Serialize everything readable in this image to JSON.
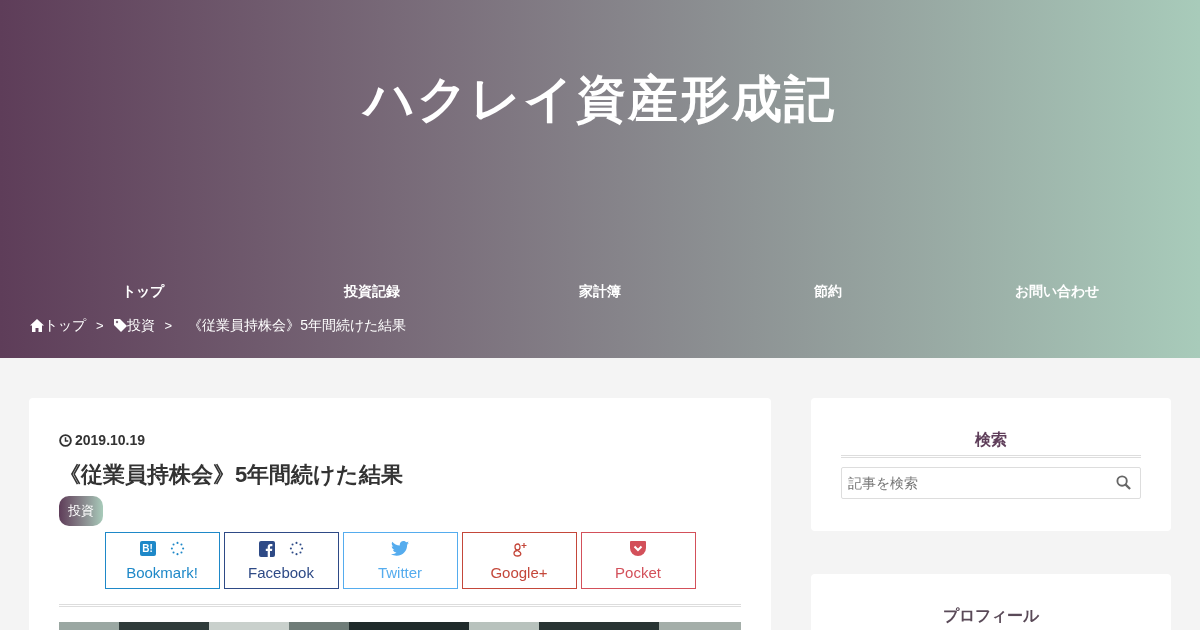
{
  "site": {
    "title": "ハクレイ資産形成記"
  },
  "nav": [
    {
      "label": "トップ"
    },
    {
      "label": "投資記録"
    },
    {
      "label": "家計簿"
    },
    {
      "label": "節約"
    },
    {
      "label": "お問い合わせ"
    }
  ],
  "breadcrumb": [
    {
      "kind": "home",
      "label": "トップ"
    },
    {
      "kind": "separator",
      "label": ">"
    },
    {
      "kind": "tag",
      "label": "投資"
    },
    {
      "kind": "separator",
      "label": ">"
    },
    {
      "kind": "current",
      "label": "《従業員持株会》5年間続けた結果"
    }
  ],
  "article": {
    "date": "2019.10.19",
    "title": "《従業員持株会》5年間続けた結果",
    "category": "投資",
    "share_buttons": [
      {
        "kind": "hatena",
        "label": "Bookmark!",
        "icon_text": "B!",
        "color": "#1e88c8",
        "count_loading": true
      },
      {
        "kind": "facebook",
        "label": "Facebook",
        "color": "#2e4a86",
        "count_loading": true
      },
      {
        "kind": "twitter",
        "label": "Twitter",
        "color": "#55acee",
        "count_loading": false
      },
      {
        "kind": "googleplus",
        "label": "Google+",
        "color": "#c4473a",
        "count_loading": false
      },
      {
        "kind": "pocket",
        "label": "Pocket",
        "color": "#d3505a",
        "count_loading": false
      }
    ]
  },
  "sidebar": [
    {
      "kind": "search",
      "title": "検索",
      "placeholder": "記事を検索"
    },
    {
      "kind": "profile",
      "title": "プロフィール"
    }
  ]
}
